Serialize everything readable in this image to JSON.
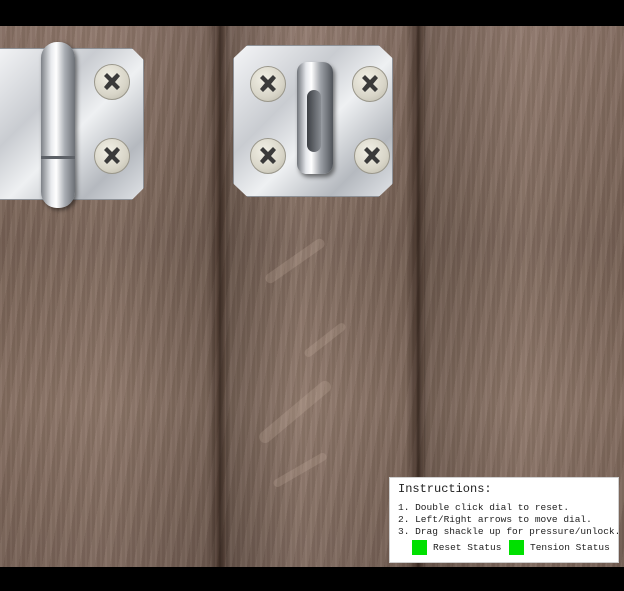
{
  "instructions": {
    "title": "Instructions:",
    "steps": [
      "1. Double click dial to reset.",
      "2. Left/Right arrows to move dial.",
      "3. Drag shackle up for pressure/unlock."
    ]
  },
  "status": {
    "reset_label": "Reset Status",
    "tension_label": "Tension Status",
    "reset_color": "#00e000",
    "tension_color": "#00e000"
  }
}
